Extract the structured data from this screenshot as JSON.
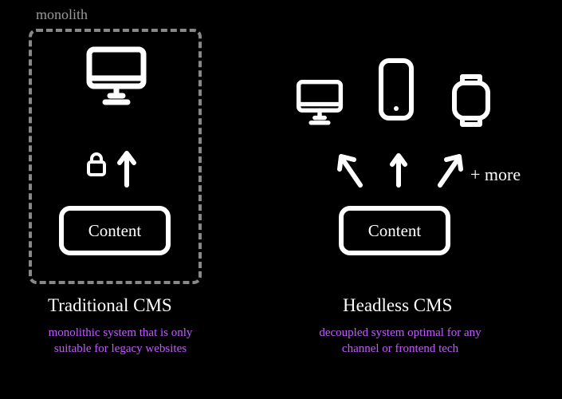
{
  "left": {
    "monolith_label": "monolith",
    "content_label": "Content",
    "title": "Traditional CMS",
    "description": "monolithic system that is only suitable for legacy websites",
    "icons": {
      "display": "desktop",
      "lock": "lock",
      "arrow": "arrow-up"
    }
  },
  "right": {
    "content_label": "Content",
    "plus_more": "+ more",
    "title": "Headless CMS",
    "description": "decoupled system optimal for any channel or frontend tech",
    "devices": [
      "desktop",
      "phone",
      "watch"
    ],
    "arrows": [
      "arrow-up-left",
      "arrow-up",
      "arrow-up-right"
    ]
  },
  "colors": {
    "bg": "#000000",
    "fg": "#ffffff",
    "muted": "#888888",
    "accent": "#c25cff"
  }
}
